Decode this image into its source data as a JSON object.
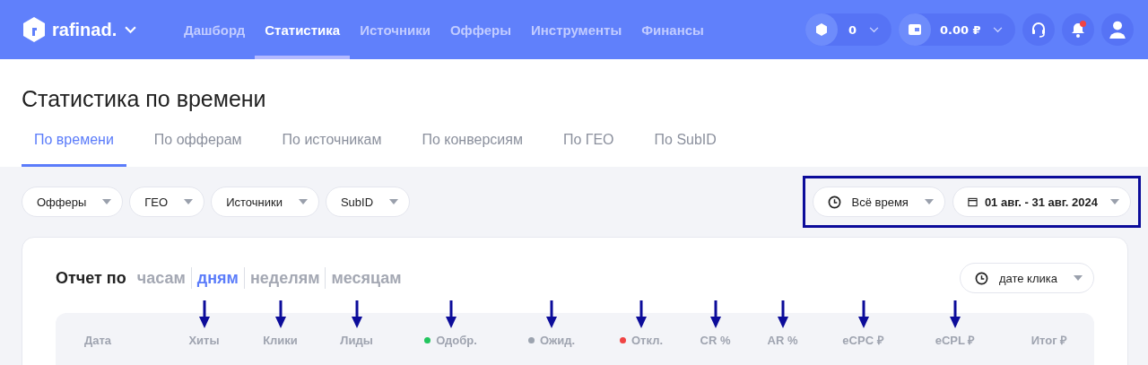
{
  "header": {
    "logo": "rafinad.",
    "nav": [
      {
        "label": "Дашборд",
        "selected": false
      },
      {
        "label": "Статистика",
        "selected": true
      },
      {
        "label": "Источники",
        "selected": false
      },
      {
        "label": "Офферы",
        "selected": false
      },
      {
        "label": "Инструменты",
        "selected": false
      },
      {
        "label": "Финансы",
        "selected": false
      }
    ],
    "counter": "0",
    "balance": "0.00 ₽",
    "notification_unread": true
  },
  "page_title": "Статистика по времени",
  "tabs": [
    {
      "label": "По времени",
      "selected": true
    },
    {
      "label": "По офферам",
      "selected": false
    },
    {
      "label": "По источникам",
      "selected": false
    },
    {
      "label": "По конверсиям",
      "selected": false
    },
    {
      "label": "По ГЕО",
      "selected": false
    },
    {
      "label": "По SubID",
      "selected": false
    }
  ],
  "filters": [
    "Офферы",
    "ГЕО",
    "Источники",
    "SubID"
  ],
  "date_filters": {
    "highlighted": true,
    "period": "Всё время",
    "range": "01 авг. - 31 авг. 2024"
  },
  "report": {
    "prefix": "Отчет по",
    "granularity": [
      {
        "label": "часам",
        "selected": false
      },
      {
        "label": "дням",
        "selected": true
      },
      {
        "label": "неделям",
        "selected": false
      },
      {
        "label": "месяцам",
        "selected": false
      }
    ],
    "date_by": "дате клика",
    "columns": [
      {
        "label": "Дата",
        "arrow": false
      },
      {
        "label": "Хиты",
        "arrow": true
      },
      {
        "label": "Клики",
        "arrow": true
      },
      {
        "label": "Лиды",
        "arrow": true
      },
      {
        "label": "Одобр.",
        "arrow": true,
        "color": "#22c55e"
      },
      {
        "label": "Ожид.",
        "arrow": true,
        "color": "#9ca3af"
      },
      {
        "label": "Откл.",
        "arrow": true,
        "color": "#f04444"
      },
      {
        "label": "CR %",
        "arrow": true
      },
      {
        "label": "AR %",
        "arrow": true
      },
      {
        "label": "eCPC ₽",
        "arrow": true
      },
      {
        "label": "eCPL ₽",
        "arrow": true
      },
      {
        "label": "Итог ₽",
        "arrow": false
      }
    ]
  }
}
